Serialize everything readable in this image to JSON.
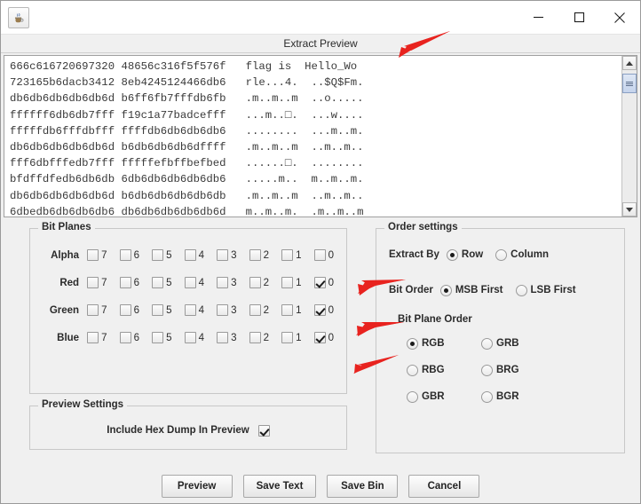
{
  "window": {
    "app_icon": "java-coffee-cup-icon",
    "minimize_label": "—",
    "maximize_label": "□",
    "close_label": "✕",
    "header_title": "Extract Preview"
  },
  "preview": {
    "lines": [
      "666c616720697320 48656c316f5f576f   flag is  Hello_Wo",
      "723165b6dacb3412 8eb4245124466db6   rle...4.  ..$Q$Fm.",
      "db6db6db6db6db6d b6ff6fb7fffdb6fb   .m..m..m  ..o.....",
      "ffffff6db6db7fff f19c1a77badcefff   ...m..□.  ...w....",
      "fffffdb6fffdbfff ffffdb6db6db6db6   ........  ...m..m.",
      "db6db6db6db6db6d b6db6db6db6dffff   .m..m..m  ..m..m..",
      "fff6dbfffedb7fff fffffefbffbefbed   ......□.  ........",
      "bfdffdfedb6db6db 6db6db6db6db6db6   .....m..  m..m..m.",
      "db6db6db6db6db6d b6db6db6db6db6db   .m..m..m  ..m..m..",
      "6dbedb6db6db6db6 db6db6db6db6db6d   m..m..m.  .m..m..m"
    ],
    "scrollbar": {
      "up_arrow": "scroll-up-icon",
      "down_arrow": "scroll-down-icon",
      "thumb_position_pct": 3
    }
  },
  "bit_planes": {
    "legend": "Bit Planes",
    "bit_labels": [
      "7",
      "6",
      "5",
      "4",
      "3",
      "2",
      "1",
      "0"
    ],
    "rows": [
      {
        "label": "Alpha",
        "checked": [
          false,
          false,
          false,
          false,
          false,
          false,
          false,
          false
        ]
      },
      {
        "label": "Red",
        "checked": [
          false,
          false,
          false,
          false,
          false,
          false,
          false,
          true
        ]
      },
      {
        "label": "Green",
        "checked": [
          false,
          false,
          false,
          false,
          false,
          false,
          false,
          true
        ]
      },
      {
        "label": "Blue",
        "checked": [
          false,
          false,
          false,
          false,
          false,
          false,
          false,
          true
        ]
      }
    ]
  },
  "order_settings": {
    "legend": "Order settings",
    "extract_by": {
      "label": "Extract By",
      "options": [
        "Row",
        "Column"
      ],
      "selected": "Row"
    },
    "bit_order": {
      "label": "Bit Order",
      "options": [
        "MSB First",
        "LSB First"
      ],
      "selected": "MSB First"
    },
    "bit_plane_order": {
      "label": "Bit Plane Order",
      "options": [
        "RGB",
        "GRB",
        "RBG",
        "BRG",
        "GBR",
        "BGR"
      ],
      "selected": "RGB"
    }
  },
  "preview_settings": {
    "legend": "Preview Settings",
    "hex_dump_label": "Include Hex Dump In Preview",
    "hex_dump_checked": true
  },
  "buttons": [
    {
      "label": "Preview"
    },
    {
      "label": "Save Text"
    },
    {
      "label": "Save Bin"
    },
    {
      "label": "Cancel"
    }
  ],
  "annotations": {
    "arrow_color": "#e8231f",
    "count": 4
  },
  "colors": {
    "window_bg": "#f0f0f0",
    "titlebar_bg": "#ffffff",
    "text_area_bg": "#ffffff",
    "panel_border": "#c8c8c8",
    "accent_red": "#e8231f"
  }
}
